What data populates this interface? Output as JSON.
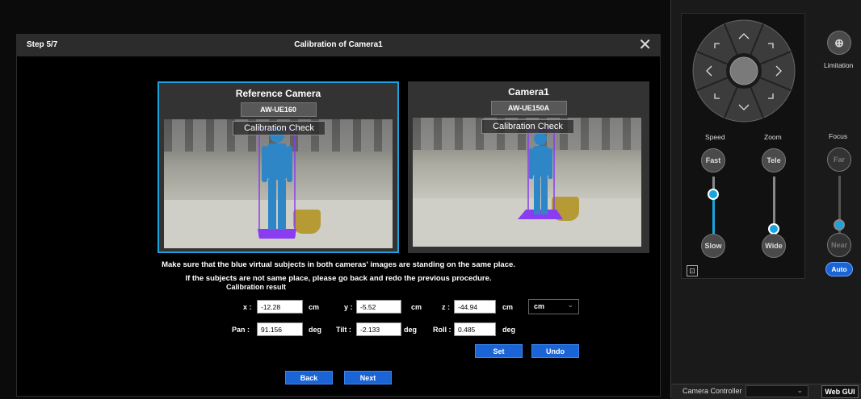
{
  "dialog": {
    "step": "Step 5/7",
    "title": "Calibration of Camera1",
    "close_icon": "close-icon"
  },
  "reference_camera": {
    "name": "Reference Camera",
    "model": "AW-UE160",
    "overlay": "Calibration Check"
  },
  "camera1": {
    "name": "Camera1",
    "model": "AW-UE150A",
    "overlay": "Calibration Check"
  },
  "instructions": {
    "line1": "Make sure that the blue virtual subjects in both cameras' images are standing on the same place.",
    "line2": "If the subjects are not same place, please go back and redo the previous procedure."
  },
  "calibration": {
    "heading": "Calibration result",
    "x_label": "x :",
    "x_value": "-12.28",
    "x_unit": "cm",
    "y_label": "y :",
    "y_value": "-5.52",
    "y_unit": "cm",
    "z_label": "z :",
    "z_value": "-44.94",
    "z_unit": "cm",
    "unit_select": "cm",
    "pan_label": "Pan :",
    "pan_value": "91.156",
    "pan_unit": "deg",
    "tilt_label": "Tilt :",
    "tilt_value": "-2.133",
    "tilt_unit": "deg",
    "roll_label": "Roll :",
    "roll_value": "0.485",
    "roll_unit": "deg"
  },
  "buttons": {
    "set": "Set",
    "undo": "Undo",
    "back": "Back",
    "next": "Next"
  },
  "controller": {
    "limitation": "Limitation",
    "speed": "Speed",
    "zoom": "Zoom",
    "focus": "Focus",
    "fast": "Fast",
    "slow": "Slow",
    "tele": "Tele",
    "wide": "Wide",
    "far": "Far",
    "near": "Near",
    "auto": "Auto",
    "speed_level": 0.3,
    "zoom_level": 0.1,
    "focus_level": 0.15
  },
  "bottom": {
    "camera_controller": "Camera Controller",
    "web_gui": "Web GUI"
  },
  "colors": {
    "accent": "#1aa3de",
    "button_blue": "#1a64d6",
    "subject_blue": "#2f86c6",
    "bbox_purple": "#8a3cf0"
  }
}
